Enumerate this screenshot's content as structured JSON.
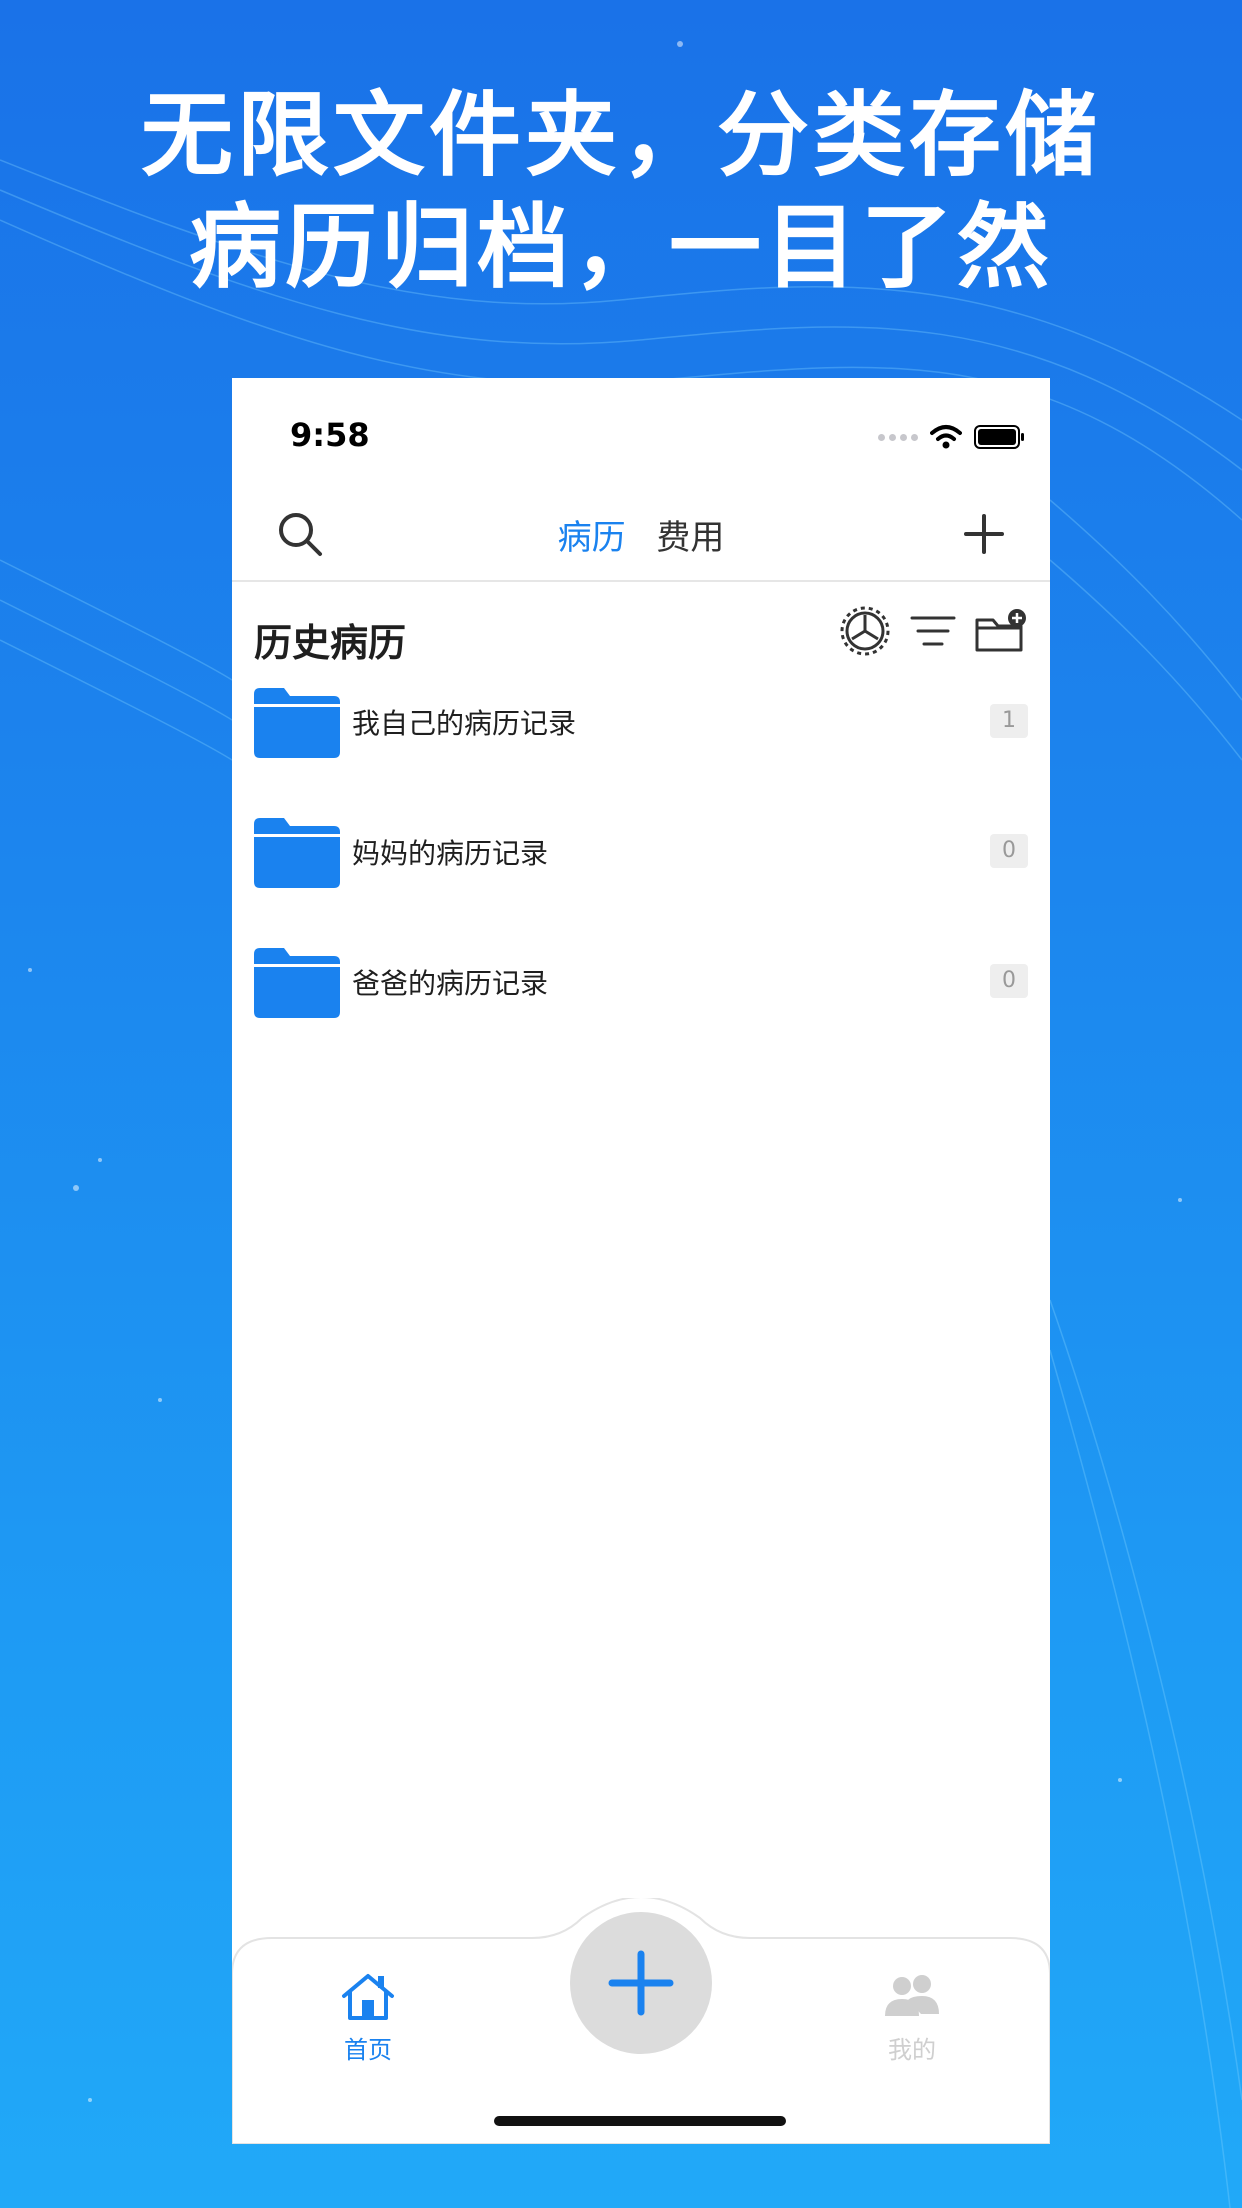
{
  "promo": {
    "line1": "无限文件夹，分类存储",
    "line2": "病历归档，一目了然"
  },
  "status_bar": {
    "time": "9:58"
  },
  "nav": {
    "tabs": [
      {
        "label": "病历",
        "active": true
      },
      {
        "label": "费用",
        "active": false
      }
    ],
    "icons": {
      "left": "search-icon",
      "right": "plus-icon"
    }
  },
  "section": {
    "title": "历史病历",
    "icons": [
      "settings-dial-icon",
      "filter-icon",
      "new-folder-icon"
    ]
  },
  "folders": [
    {
      "name": "我自己的病历记录",
      "count": "1"
    },
    {
      "name": "妈妈的病历记录",
      "count": "0"
    },
    {
      "name": "爸爸的病历记录",
      "count": "0"
    }
  ],
  "tab_bar": {
    "home_label": "首页",
    "mine_label": "我的",
    "center": "add-icon"
  },
  "colors": {
    "accent": "#1a82ef",
    "folder": "#1a82ef",
    "inactive": "#cfcfcf"
  }
}
